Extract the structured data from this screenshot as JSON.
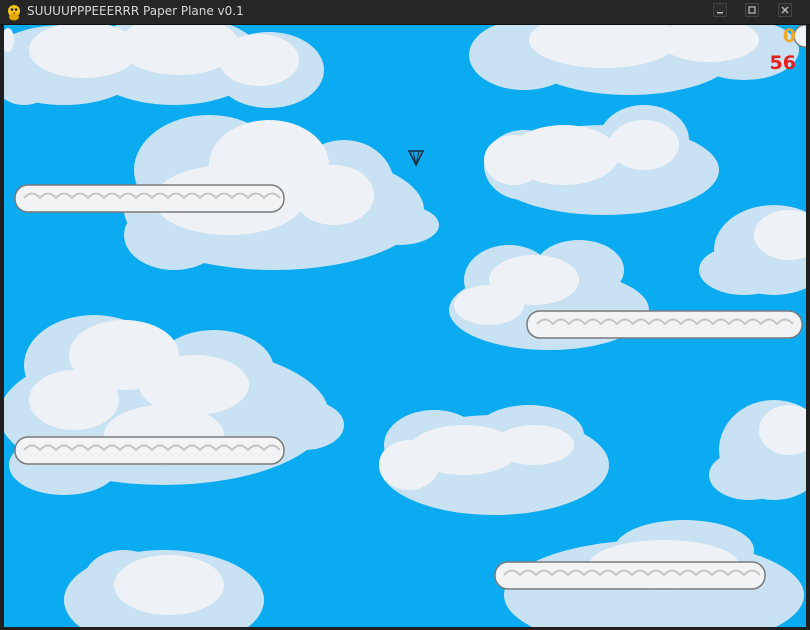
{
  "window": {
    "title": "SUUUUPPPEEERRR Paper Plane v0.1",
    "app_icon": "pygame-snake-icon",
    "buttons": [
      "minimize-icon",
      "maximize-icon",
      "close-icon"
    ]
  },
  "hud": {
    "score": "0",
    "timer": "56",
    "score_color": "#f0a82b",
    "timer_color": "#e8201f"
  },
  "colors": {
    "sky": "#0aabf0",
    "cloud_light": "#eef2f6",
    "cloud_mid": "#d4e6f3",
    "cloud_shadow": "#b3d6ee"
  },
  "sprites": {
    "player": "paper-plane",
    "obstacle": "cloud-platform"
  }
}
